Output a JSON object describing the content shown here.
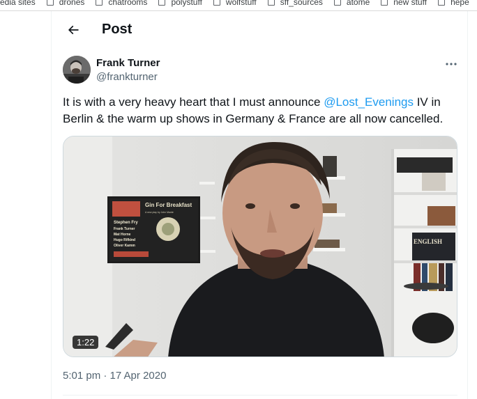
{
  "bookmarks": [
    "media sites",
    "drones",
    "chatrooms",
    "polystuff",
    "wolfstuff",
    "sff_sources",
    "atome",
    "new stuff",
    "hepe"
  ],
  "header": {
    "title": "Post"
  },
  "author": {
    "name": "Frank Turner",
    "handle": "@frankturner"
  },
  "tweet": {
    "text_before": "It is with a very heavy heart that I must announce ",
    "mention": "@Lost_Evenings",
    "text_after": " IV in Berlin & the warm up shows in Germany & France are all now cancelled."
  },
  "media": {
    "duration": "1:22",
    "poster": {
      "title": "Gin For Breakfast",
      "subtitle": "A new play by John Mante",
      "names": [
        "Stephen Fry",
        "Frank Turner",
        "Mat Horne",
        "Hugo Rifkind",
        "Oliver Kamm"
      ]
    },
    "book_text": "ENGLISH"
  },
  "timestamp": "5:01 pm · 17 Apr 2020",
  "colors": {
    "accent": "#1d9bf0",
    "secondary_text": "#536471",
    "primary_text": "#0f1419"
  }
}
